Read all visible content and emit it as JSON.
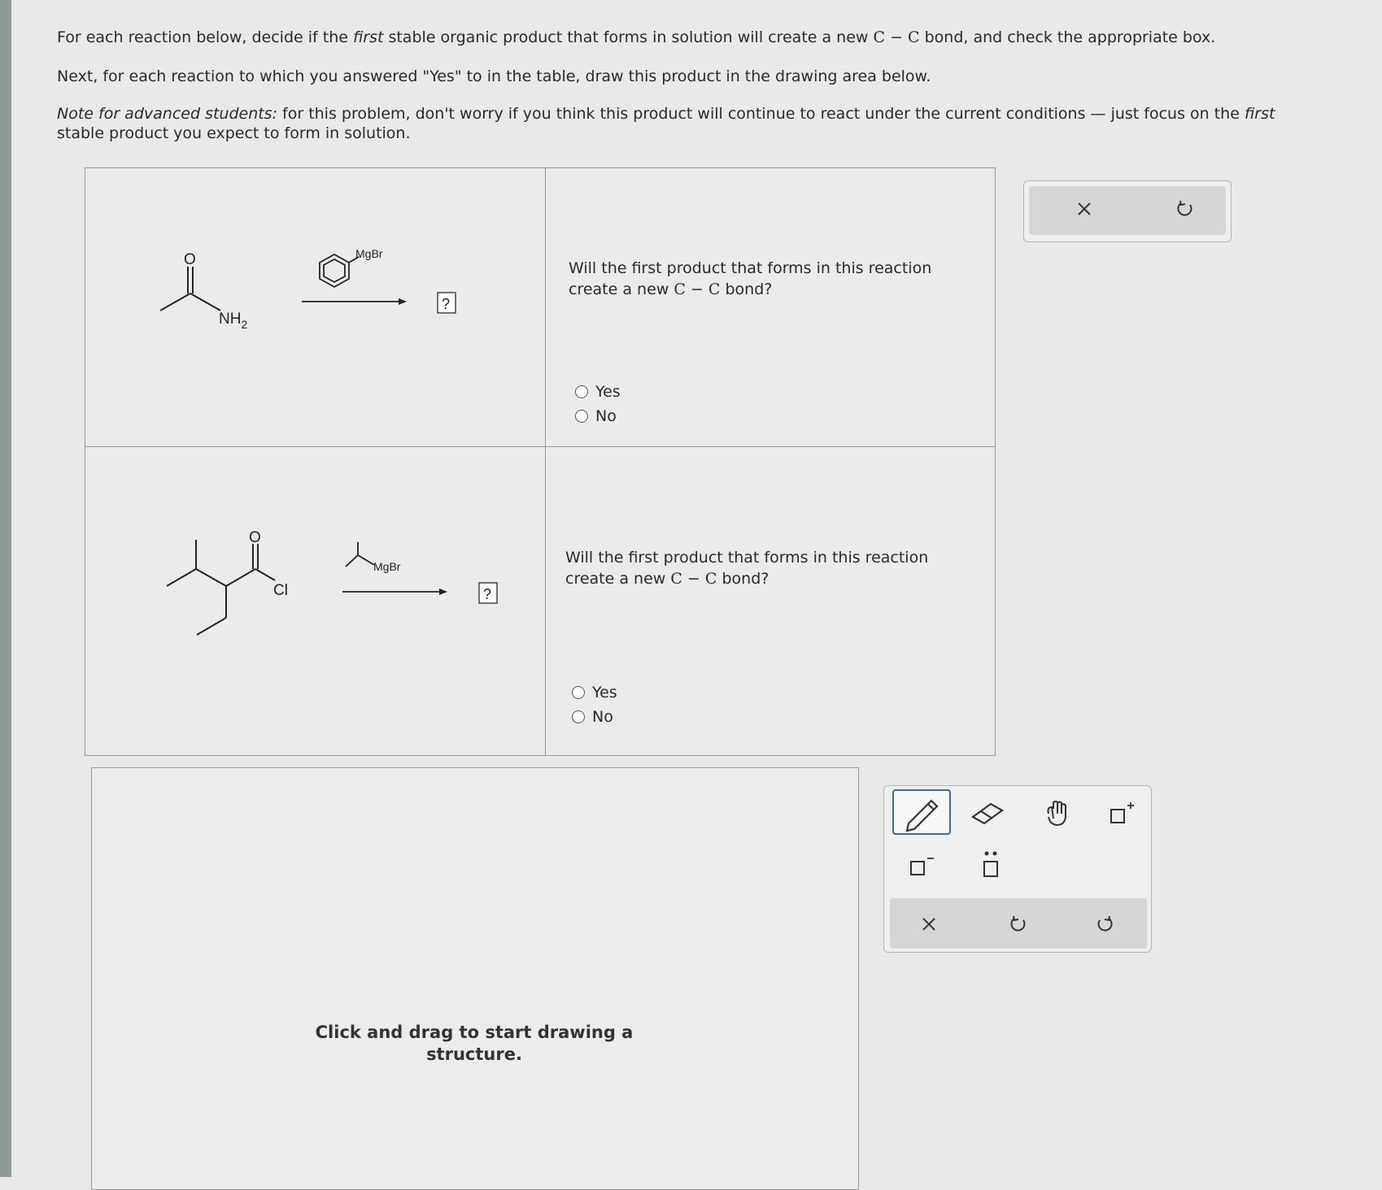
{
  "instructions": {
    "line1_pre": "For each reaction below, decide if the ",
    "line1_em": "first",
    "line1_mid": " stable organic product that forms in solution will create a new ",
    "line1_cc": "C − C",
    "line1_post": " bond, and check the appropriate box.",
    "line2": "Next, for each reaction to which you answered \"Yes\" to in the table, draw this product in the drawing area below.",
    "note_em": "Note for advanced students:",
    "note_pre": " for this problem, don't worry if you think this product will continue to react under the current conditions — just focus on the ",
    "note_em2": "first",
    "note_post": "stable product you expect to form in solution."
  },
  "reactions": [
    {
      "reactant_labels": {
        "o": "O",
        "group": "NH2"
      },
      "reagent_label": "MgBr",
      "product": "?",
      "question_pre": "Will the first product that forms in this reaction create a new ",
      "question_cc": "C − C",
      "question_post": " bond?",
      "options": [
        "Yes",
        "No"
      ]
    },
    {
      "reactant_labels": {
        "o": "O",
        "group": "Cl"
      },
      "reagent_label": "MgBr",
      "product": "?",
      "question_pre": "Will the first product that forms in this reaction create a new ",
      "question_cc": "C − C",
      "question_post": " bond?",
      "options": [
        "Yes",
        "No"
      ]
    }
  ],
  "drawing_area": {
    "hint": "Click and drag to start drawing a structure."
  },
  "icons": {
    "top": [
      "close-icon",
      "undo-icon"
    ],
    "tools": [
      "pencil-icon",
      "eraser-icon",
      "hand-icon",
      "add-charge-icon",
      "remove-charge-icon",
      "lone-pair-icon"
    ],
    "actions": [
      "close-icon",
      "undo-icon",
      "redo-icon"
    ]
  },
  "colors": {
    "selected_tool_border": "#3d6b95"
  }
}
